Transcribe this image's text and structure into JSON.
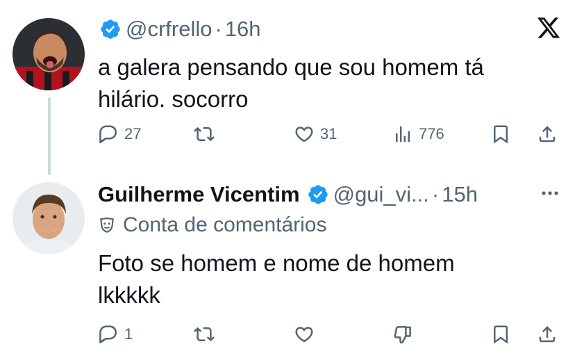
{
  "tweets": [
    {
      "handle": "@crfrello",
      "separator": "·",
      "time": "16h",
      "text_line1": "a galera pensando que sou homem tá",
      "text_line2": "hilário. socorro",
      "actions": {
        "replies": "27",
        "retweets": "",
        "likes": "31",
        "views": "776"
      }
    },
    {
      "name": "Guilherme Vicentim",
      "handle": "@gui_vi...",
      "separator": "·",
      "time": "15h",
      "context_label": "Conta de comentários",
      "text_line1": "Foto se homem e nome de homem",
      "text_line2": "lkkkkk",
      "actions": {
        "replies": "1"
      }
    }
  ],
  "colors": {
    "text": "#0f1419",
    "muted": "#536471",
    "verified": "#1d9bf0",
    "thread_line": "#cfd9de"
  },
  "icons": {
    "reply": "reply-icon",
    "retweet": "retweet-icon",
    "like": "heart-icon",
    "views": "views-chart-icon",
    "bookmark": "bookmark-icon",
    "share": "share-icon",
    "dislike": "thumbs-down-icon",
    "more": "more-options-icon",
    "brand": "x-logo-icon",
    "context": "theater-mask-icon"
  }
}
